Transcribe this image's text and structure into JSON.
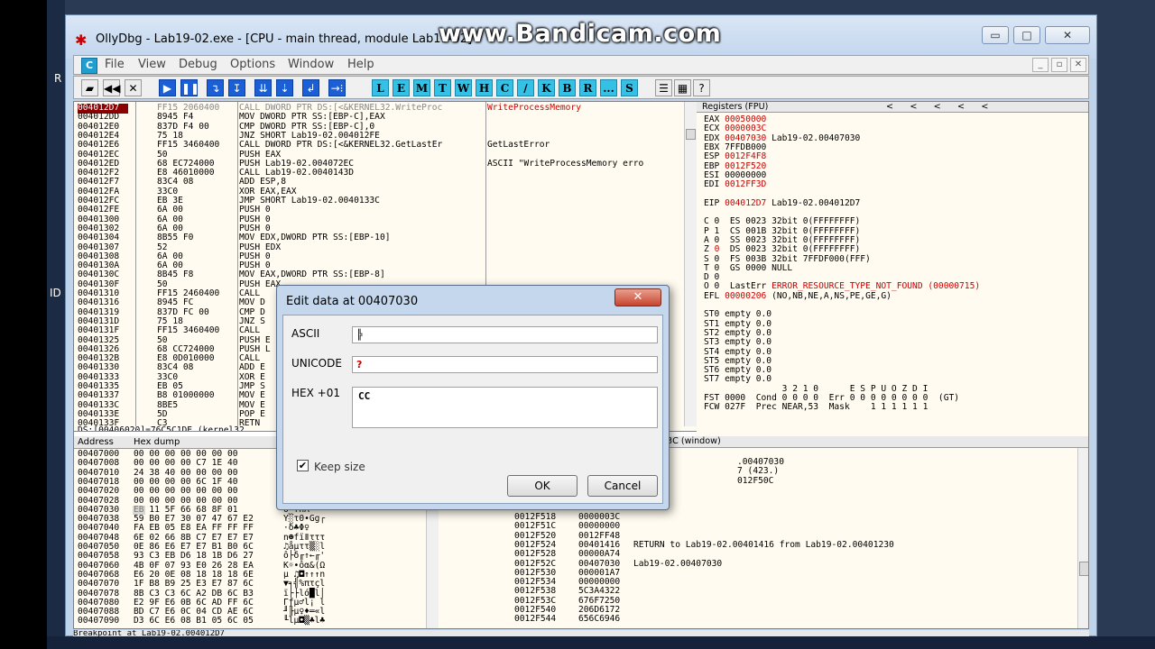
{
  "watermark": "www.Bandicam.com",
  "side_chars": [
    "R",
    "ID"
  ],
  "window": {
    "title": "OllyDbg - Lab19-02.exe - [CPU - main thread, module Lab19-02]",
    "controls": {
      "minimize": "▭",
      "maximize": "□",
      "close": "✕"
    }
  },
  "menubar": {
    "cpu_icon": "C",
    "items": [
      "File",
      "View",
      "Debug",
      "Options",
      "Window",
      "Help"
    ],
    "mdi": {
      "minimize": "_",
      "restore": "▫",
      "close": "✕"
    }
  },
  "toolbar": {
    "plain": [
      {
        "name": "open-icon",
        "glyph": "▰"
      },
      {
        "name": "rewind-icon",
        "glyph": "◀◀"
      },
      {
        "name": "close-icon",
        "glyph": "✕"
      }
    ],
    "blue": [
      {
        "name": "run-icon",
        "glyph": "▶"
      },
      {
        "name": "pause-icon",
        "glyph": "❚❚"
      },
      {
        "name": "step-into-icon",
        "glyph": "↴"
      },
      {
        "name": "step-over-icon",
        "glyph": "↧"
      },
      {
        "name": "trace-into-icon",
        "glyph": "⇊"
      },
      {
        "name": "trace-over-icon",
        "glyph": "⇣"
      },
      {
        "name": "execute-till-return-icon",
        "glyph": "↲"
      },
      {
        "name": "go-to-icon",
        "glyph": "→⁝"
      }
    ],
    "letters": [
      "L",
      "E",
      "M",
      "T",
      "W",
      "H",
      "C",
      "/",
      "K",
      "B",
      "R",
      "...",
      "S"
    ],
    "extra": [
      {
        "name": "list-icon",
        "glyph": "☰"
      },
      {
        "name": "grid-icon",
        "glyph": "▦"
      },
      {
        "name": "help-icon",
        "glyph": "?"
      }
    ]
  },
  "disasm": {
    "rows": [
      {
        "addr": "004012D7",
        "hex": "FF15 2060400",
        "asm": "CALL DWORD PTR DS:[<&KERNEL32.WriteProc",
        "comment": "WriteProcessMemory",
        "sel": true
      },
      {
        "addr": "004012DD",
        "hex": "8945 F4",
        "asm": "MOV DWORD PTR SS:[EBP-C],EAX",
        "comment": ""
      },
      {
        "addr": "004012E0",
        "hex": "837D F4 00",
        "asm": "CMP DWORD PTR SS:[EBP-C],0",
        "comment": ""
      },
      {
        "addr": "004012E4",
        "hex": "75 18",
        "asm": "JNZ SHORT Lab19-02.004012FE",
        "comment": ""
      },
      {
        "addr": "004012E6",
        "hex": "FF15 3460400",
        "asm": "CALL DWORD PTR DS:[<&KERNEL32.GetLastEr",
        "comment": "GetLastError"
      },
      {
        "addr": "004012EC",
        "hex": "50",
        "asm": "PUSH EAX",
        "comment": ""
      },
      {
        "addr": "004012ED",
        "hex": "68 EC724000",
        "asm": "PUSH Lab19-02.004072EC",
        "comment": "ASCII \"WriteProcessMemory erro"
      },
      {
        "addr": "004012F2",
        "hex": "E8 46010000",
        "asm": "CALL Lab19-02.0040143D",
        "comment": ""
      },
      {
        "addr": "004012F7",
        "hex": "83C4 08",
        "asm": "ADD ESP,8",
        "comment": ""
      },
      {
        "addr": "004012FA",
        "hex": "33C0",
        "asm": "XOR EAX,EAX",
        "comment": ""
      },
      {
        "addr": "004012FC",
        "hex": "EB 3E",
        "asm": "JMP SHORT Lab19-02.0040133C",
        "comment": ""
      },
      {
        "addr": "004012FE",
        "hex": "6A 00",
        "asm": "PUSH 0",
        "comment": ""
      },
      {
        "addr": "00401300",
        "hex": "6A 00",
        "asm": "PUSH 0",
        "comment": ""
      },
      {
        "addr": "00401302",
        "hex": "6A 00",
        "asm": "PUSH 0",
        "comment": ""
      },
      {
        "addr": "00401304",
        "hex": "8B55 F0",
        "asm": "MOV EDX,DWORD PTR SS:[EBP-10]",
        "comment": ""
      },
      {
        "addr": "00401307",
        "hex": "52",
        "asm": "PUSH EDX",
        "comment": ""
      },
      {
        "addr": "00401308",
        "hex": "6A 00",
        "asm": "PUSH 0",
        "comment": ""
      },
      {
        "addr": "0040130A",
        "hex": "6A 00",
        "asm": "PUSH 0",
        "comment": ""
      },
      {
        "addr": "0040130C",
        "hex": "8B45 F8",
        "asm": "MOV EAX,DWORD PTR SS:[EBP-8]",
        "comment": ""
      },
      {
        "addr": "0040130F",
        "hex": "50",
        "asm": "PUSH EAX",
        "comment": ""
      },
      {
        "addr": "00401310",
        "hex": "FF15 2460400",
        "asm": "CALL",
        "comment": ""
      },
      {
        "addr": "00401316",
        "hex": "8945 FC",
        "asm": "MOV D",
        "comment": ""
      },
      {
        "addr": "00401319",
        "hex": "837D FC 00",
        "asm": "CMP D",
        "comment": ""
      },
      {
        "addr": "0040131D",
        "hex": "75 18",
        "asm": "JNZ S",
        "comment": ""
      },
      {
        "addr": "0040131F",
        "hex": "FF15 3460400",
        "asm": "CALL",
        "comment": ""
      },
      {
        "addr": "00401325",
        "hex": "50",
        "asm": "PUSH E",
        "comment": ""
      },
      {
        "addr": "00401326",
        "hex": "68 CC724000",
        "asm": "PUSH L",
        "comment": "rr"
      },
      {
        "addr": "0040132B",
        "hex": "E8 0D010000",
        "asm": "CALL",
        "comment": ""
      },
      {
        "addr": "00401330",
        "hex": "83C4 08",
        "asm": "ADD E",
        "comment": ""
      },
      {
        "addr": "00401333",
        "hex": "33C0",
        "asm": "XOR E",
        "comment": ""
      },
      {
        "addr": "00401335",
        "hex": "EB 05",
        "asm": "JMP S",
        "comment": ""
      },
      {
        "addr": "00401337",
        "hex": "B8 01000000",
        "asm": "MOV E",
        "comment": ""
      },
      {
        "addr": "0040133C",
        "hex": "8BE5",
        "asm": "MOV E",
        "comment": ""
      },
      {
        "addr": "0040133E",
        "hex": "5D",
        "asm": "POP E",
        "comment": ""
      },
      {
        "addr": "0040133F",
        "hex": "C3",
        "asm": "RETN",
        "comment": ""
      }
    ],
    "info_line": "DS:[00406020]=76C5C1DE (kernel32"
  },
  "registers": {
    "header": "Registers (FPU)",
    "lines": [
      {
        "t": "EAX ",
        "v": "00050000",
        "r": ""
      },
      {
        "t": "ECX ",
        "v": "0000003C",
        "r": ""
      },
      {
        "t": "EDX ",
        "v": "00407030",
        "r": " Lab19-02.00407030"
      },
      {
        "t": "EBX 7FFDB000",
        "v": "",
        "r": ""
      },
      {
        "t": "ESP ",
        "v": "0012F4F8",
        "r": ""
      },
      {
        "t": "EBP ",
        "v": "0012F520",
        "r": ""
      },
      {
        "t": "ESI 00000000",
        "v": "",
        "r": ""
      },
      {
        "t": "EDI ",
        "v": "0012FF3D",
        "r": ""
      },
      {
        "t": "",
        "v": "",
        "r": ""
      },
      {
        "t": "EIP ",
        "v": "004012D7",
        "r": " Lab19-02.004012D7"
      },
      {
        "t": "",
        "v": "",
        "r": ""
      },
      {
        "t": "C 0  ES 0023 32bit 0(FFFFFFFF)",
        "v": "",
        "r": ""
      },
      {
        "t": "P 1  CS 001B 32bit 0(FFFFFFFF)",
        "v": "",
        "r": ""
      },
      {
        "t": "A 0  SS 0023 32bit 0(FFFFFFFF)",
        "v": "",
        "r": ""
      },
      {
        "t": "Z ",
        "v": "0",
        "r": "  DS 0023 32bit 0(FFFFFFFF)"
      },
      {
        "t": "S 0  FS 003B 32bit 7FFDF000(FFF)",
        "v": "",
        "r": ""
      },
      {
        "t": "T 0  GS 0000 NULL",
        "v": "",
        "r": ""
      },
      {
        "t": "D 0",
        "v": "",
        "r": ""
      },
      {
        "t": "O 0  LastErr ",
        "v": "ERROR_RESOURCE_TYPE_NOT_FOUND (00000715)",
        "r": ""
      },
      {
        "t": "EFL ",
        "v": "00000206",
        "r": " (NO,NB,NE,A,NS,PE,GE,G)"
      },
      {
        "t": "",
        "v": "",
        "r": ""
      },
      {
        "t": "ST0 empty 0.0",
        "v": "",
        "r": ""
      },
      {
        "t": "ST1 empty 0.0",
        "v": "",
        "r": ""
      },
      {
        "t": "ST2 empty 0.0",
        "v": "",
        "r": ""
      },
      {
        "t": "ST3 empty 0.0",
        "v": "",
        "r": ""
      },
      {
        "t": "ST4 empty 0.0",
        "v": "",
        "r": ""
      },
      {
        "t": "ST5 empty 0.0",
        "v": "",
        "r": ""
      },
      {
        "t": "ST6 empty 0.0",
        "v": "",
        "r": ""
      },
      {
        "t": "ST7 empty 0.0",
        "v": "",
        "r": ""
      },
      {
        "t": "               3 2 1 0      E S P U O Z D I",
        "v": "",
        "r": ""
      },
      {
        "t": "FST 0000  Cond 0 0 0 0  Err 0 0 0 0 0 0 0 0  (GT)",
        "v": "",
        "r": ""
      },
      {
        "t": "FCW 027F  Prec NEAR,53  Mask    1 1 1 1 1 1",
        "v": "",
        "r": ""
      }
    ]
  },
  "dump": {
    "headers": {
      "address": "Address",
      "hex": "Hex dump"
    },
    "rows": [
      {
        "a": "00407000",
        "h": "00 00 00 00 00 00 00",
        "s": ""
      },
      {
        "a": "00407008",
        "h": "00 00 00 00 C7 1E 40",
        "s": ""
      },
      {
        "a": "00407010",
        "h": "24 38 40 00 00 00 00",
        "s": ""
      },
      {
        "a": "00407018",
        "h": "00 00 00 00 6C 1F 40",
        "s": ""
      },
      {
        "a": "00407020",
        "h": "00 00 00 00 00 00 00",
        "s": ""
      },
      {
        "a": "00407028",
        "h": "00 00 00 00 00 00 00",
        "s": "   _?u#dP"
      },
      {
        "a": "00407030",
        "h": "EB 11 5F 66 68 8F 01",
        "s": "δ_fhÅ"
      },
      {
        "a": "00407038",
        "h": "59 B0 E7 30 07 47 67 E2",
        "s": "Y░τ0•Gg┌"
      },
      {
        "a": "00407040",
        "h": "FA EB 05 E8 EA FF FF FF",
        "s": "·δ♣Φ♀"
      },
      {
        "a": "00407048",
        "h": "6E 02 66 8B C7 E7 E7 E7",
        "s": "n☻fïǁτττ"
      },
      {
        "a": "00407050",
        "h": "0E 86 E6 E7 E7 B1 B0 6C",
        "s": "♫åµττ▒░l"
      },
      {
        "a": "00407058",
        "h": "93 C3 EB D6 18 1B D6 27",
        "s": "ô├δ╓↑←╓'"
      },
      {
        "a": "00407060",
        "h": "4B 0F 07 93 E0 26 28 EA",
        "s": "K☼•ôα&(Ω"
      },
      {
        "a": "00407068",
        "h": "E6 20 0E 08 18 18 18 6E",
        "s": "µ ♫◘↑↑↑n"
      },
      {
        "a": "00407070",
        "h": "1F B8 B9 25 E3 E7 87 6C",
        "s": "▼╕╣%πτçl"
      },
      {
        "a": "00407078",
        "h": "8B C3 C3 6C A2 DB 6C B3",
        "s": "ï├├ló█l│"
      },
      {
        "a": "00407080",
        "h": "E2 9F E6 0B 6C AD FF 6C",
        "s": "Γƒµ♂l¡ l"
      },
      {
        "a": "00407088",
        "h": "BD C7 E6 0C 04 CD AE 6C",
        "s": "╜╟µ♀♦═«l"
      },
      {
        "a": "00407090",
        "h": "D3 6C E6 08 B1 05 6C 05",
        "s": "╙lµ◘▒♣l♣"
      }
    ]
  },
  "stack": {
    "header": "3C (window)",
    "partial_lines": [
      ".00407030",
      "7 (423.)",
      "012F50C"
    ],
    "rows": [
      {
        "a": "0012F518",
        "v": "0000003C",
        "c": ""
      },
      {
        "a": "0012F51C",
        "v": "00000000",
        "c": ""
      },
      {
        "a": "0012F520",
        "v": "0012FF48",
        "c": ""
      },
      {
        "a": "0012F524",
        "v": "00401416",
        "c": "RETURN to Lab19-02.00401416 from Lab19-02.00401230"
      },
      {
        "a": "0012F528",
        "v": "00000A74",
        "c": ""
      },
      {
        "a": "0012F52C",
        "v": "00407030",
        "c": "Lab19-02.00407030"
      },
      {
        "a": "0012F530",
        "v": "000001A7",
        "c": ""
      },
      {
        "a": "0012F534",
        "v": "00000000",
        "c": ""
      },
      {
        "a": "0012F538",
        "v": "5C3A4322",
        "c": ""
      },
      {
        "a": "0012F53C",
        "v": "676F7250",
        "c": ""
      },
      {
        "a": "0012F540",
        "v": "206D6172",
        "c": ""
      },
      {
        "a": "0012F544",
        "v": "656C6946",
        "c": ""
      }
    ]
  },
  "statusbar": {
    "text": "Breakpoint at Lab19-02.004012D7"
  },
  "dialog": {
    "title": "Edit data at 00407030",
    "close": "✕",
    "ascii_label": "ASCII",
    "ascii_value": "╠",
    "unicode_label": "UNICODE",
    "unicode_value": "?",
    "hex_label": "HEX +01",
    "hex_value": "CC",
    "keep_size_label": "Keep size",
    "keep_size_checked": "✔",
    "ok": "OK",
    "cancel": "Cancel"
  }
}
